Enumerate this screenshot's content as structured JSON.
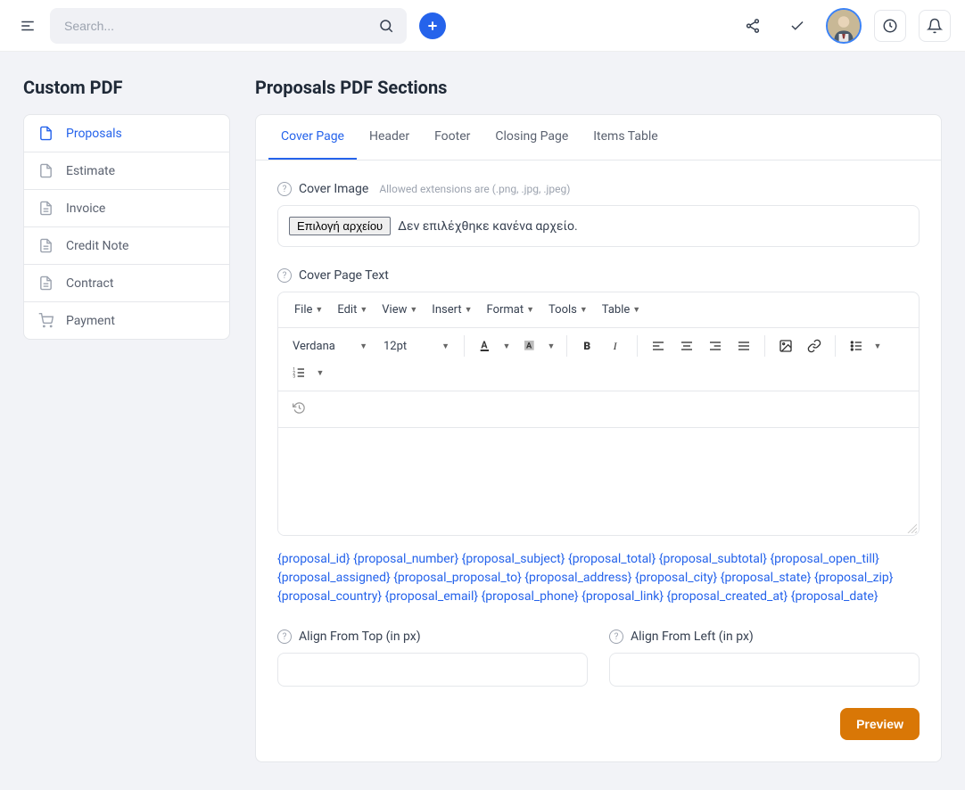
{
  "topbar": {
    "search_placeholder": "Search..."
  },
  "sidebar": {
    "title": "Custom PDF",
    "items": [
      {
        "label": "Proposals",
        "icon": "file-icon",
        "active": true
      },
      {
        "label": "Estimate",
        "icon": "file-blank-icon"
      },
      {
        "label": "Invoice",
        "icon": "file-lines-icon"
      },
      {
        "label": "Credit Note",
        "icon": "file-lines-icon"
      },
      {
        "label": "Contract",
        "icon": "file-lines-icon"
      },
      {
        "label": "Payment",
        "icon": "cart-icon"
      }
    ]
  },
  "content": {
    "title": "Proposals PDF Sections",
    "tabs": [
      "Cover Page",
      "Header",
      "Footer",
      "Closing Page",
      "Items Table"
    ],
    "active_tab": 0,
    "cover_image": {
      "label": "Cover Image",
      "hint": "Allowed extensions are (.png, .jpg, .jpeg)",
      "choose_button": "Επιλογή αρχείου",
      "no_file": "Δεν επιλέχθηκε κανένα αρχείο."
    },
    "cover_text": {
      "label": "Cover Page Text",
      "menubar": [
        "File",
        "Edit",
        "View",
        "Insert",
        "Format",
        "Tools",
        "Table"
      ],
      "font_family": "Verdana",
      "font_size": "12pt"
    },
    "placeholders": "{proposal_id} {proposal_number} {proposal_subject} {proposal_total} {proposal_subtotal} {proposal_open_till} {proposal_assigned} {proposal_proposal_to} {proposal_address} {proposal_city} {proposal_state} {proposal_zip} {proposal_country} {proposal_email} {proposal_phone} {proposal_link} {proposal_created_at} {proposal_date}",
    "align_top_label": "Align From Top (in px)",
    "align_left_label": "Align From Left (in px)",
    "preview_button": "Preview"
  }
}
